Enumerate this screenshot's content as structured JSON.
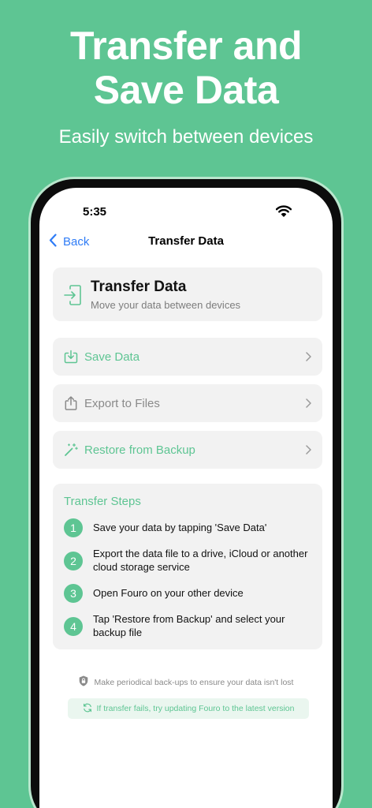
{
  "promo": {
    "headline_line1": "Transfer and",
    "headline_line2": "Save Data",
    "subheadline": "Easily switch between devices"
  },
  "status_bar": {
    "time": "5:35"
  },
  "nav": {
    "back_label": "Back",
    "title": "Transfer Data"
  },
  "hero": {
    "title": "Transfer Data",
    "subtitle": "Move your data between devices",
    "icon": "import-arrow-icon"
  },
  "actions": [
    {
      "label": "Save Data",
      "icon": "download-tray-icon",
      "enabled": true
    },
    {
      "label": "Export to Files",
      "icon": "share-icon",
      "enabled": false
    },
    {
      "label": "Restore from Backup",
      "icon": "magic-wand-icon",
      "enabled": true
    }
  ],
  "steps": {
    "title": "Transfer Steps",
    "items": [
      {
        "num": "1",
        "text": "Save your data by tapping 'Save Data'"
      },
      {
        "num": "2",
        "text": "Export the data file to a drive, iCloud or another cloud storage service"
      },
      {
        "num": "3",
        "text": "Open Fouro on your other device"
      },
      {
        "num": "4",
        "text": "Tap 'Restore from Backup' and select your backup file"
      }
    ]
  },
  "note": "Make periodical back-ups to ensure your data isn't lost",
  "tip": "If transfer fails, try updating Fouro to the latest version",
  "colors": {
    "accent_green": "#5ec593",
    "ios_blue": "#2f7cf6",
    "card_gray": "#f2f2f2",
    "muted_text": "#8a8a8a"
  }
}
